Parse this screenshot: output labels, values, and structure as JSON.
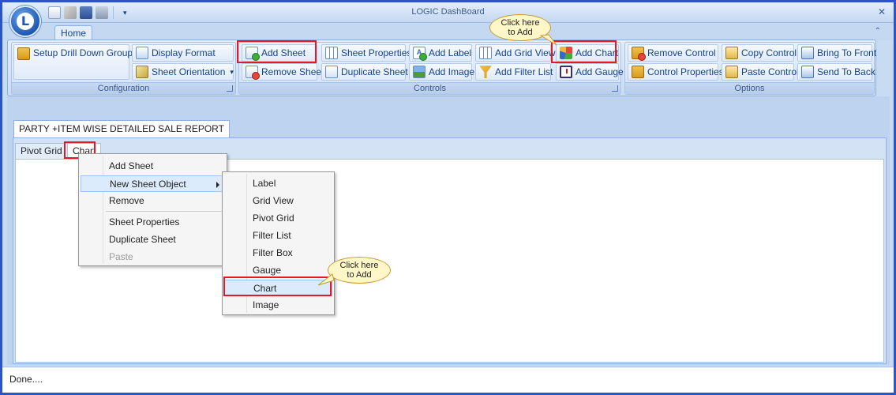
{
  "window": {
    "title": "LOGIC DashBoard",
    "close_glyph": "✕"
  },
  "quick_access": {
    "more_glyph": "▾"
  },
  "ribbon": {
    "tab": "Home",
    "collapse_glyph": "⌃",
    "groups": {
      "configuration": {
        "label": "Configuration",
        "setup_drill": "Setup Drill Down Groups",
        "display_format": "Display Format",
        "sheet_orientation": "Sheet Orientation",
        "dropdown_glyph": "▾"
      },
      "controls": {
        "label": "Controls",
        "add_sheet": "Add Sheet",
        "remove_sheet": "Remove Sheet",
        "sheet_properties": "Sheet Properties",
        "duplicate_sheet": "Duplicate Sheet",
        "add_label": "Add Label",
        "add_image": "Add Image",
        "add_grid_view": "Add Grid View",
        "add_filter_list": "Add Filter List",
        "add_chart": "Add Chart",
        "add_gauge": "Add Gauge"
      },
      "options": {
        "label": "Options",
        "remove_control": "Remove Control",
        "control_properties": "Control Properties",
        "copy_control": "Copy Control",
        "paste_control": "Paste Control",
        "bring_to_front": "Bring To Front",
        "send_to_back": "Send To Back"
      }
    }
  },
  "callouts": {
    "top": [
      "Click here",
      "to Add"
    ],
    "menu": [
      "Click here",
      "to Add"
    ]
  },
  "report": {
    "tab": "PARTY +ITEM WISE DETAILED SALE REPORT",
    "subtabs": [
      "Pivot Grid",
      "Chart"
    ]
  },
  "context_menu": {
    "items": [
      "Add Sheet",
      "New Sheet Object",
      "Remove",
      "Sheet Properties",
      "Duplicate Sheet",
      "Paste"
    ]
  },
  "submenu": {
    "items": [
      "Label",
      "Grid View",
      "Pivot Grid",
      "Filter List",
      "Filter Box",
      "Gauge",
      "Chart",
      "Image"
    ]
  },
  "status": {
    "text": "Done...."
  },
  "colors": {
    "highlight_red": "#e01b24",
    "ribbon_blue": "#c7dbf3",
    "text_blue": "#15428b"
  }
}
